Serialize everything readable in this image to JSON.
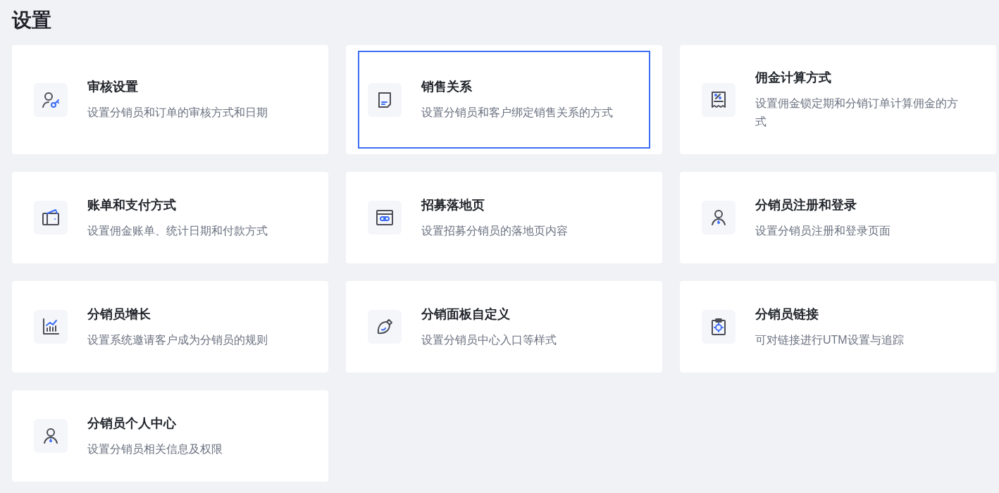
{
  "title": "设置",
  "cards": [
    {
      "kind": "user-key",
      "title": "审核设置",
      "description": "设置分销员和订单的审核方式和日期",
      "selected": false
    },
    {
      "kind": "document",
      "title": "销售关系",
      "description": "设置分销员和客户绑定销售关系的方式",
      "selected": true
    },
    {
      "kind": "receipt",
      "title": "佣金计算方式",
      "description": "设置佣金锁定期和分销订单计算佣金的方式",
      "selected": false
    },
    {
      "kind": "wallet",
      "title": "账单和支付方式",
      "description": "设置佣金账单、统计日期和付款方式",
      "selected": false
    },
    {
      "kind": "browser-link",
      "title": "招募落地页",
      "description": "设置招募分销员的落地页内容",
      "selected": false
    },
    {
      "kind": "user",
      "title": "分销员注册和登录",
      "description": "设置分销员注册和登录页面",
      "selected": false
    },
    {
      "kind": "chart",
      "title": "分销员增长",
      "description": "设置系统邀请客户成为分销员的规则",
      "selected": false
    },
    {
      "kind": "brush",
      "title": "分销面板自定义",
      "description": "设置分销员中心入口等样式",
      "selected": false
    },
    {
      "kind": "clipboard",
      "title": "分销员链接",
      "description": "可对链接进行UTM设置与追踪",
      "selected": false
    },
    {
      "kind": "user",
      "title": "分销员个人中心",
      "description": "设置分销员相关信息及权限",
      "selected": false
    }
  ]
}
